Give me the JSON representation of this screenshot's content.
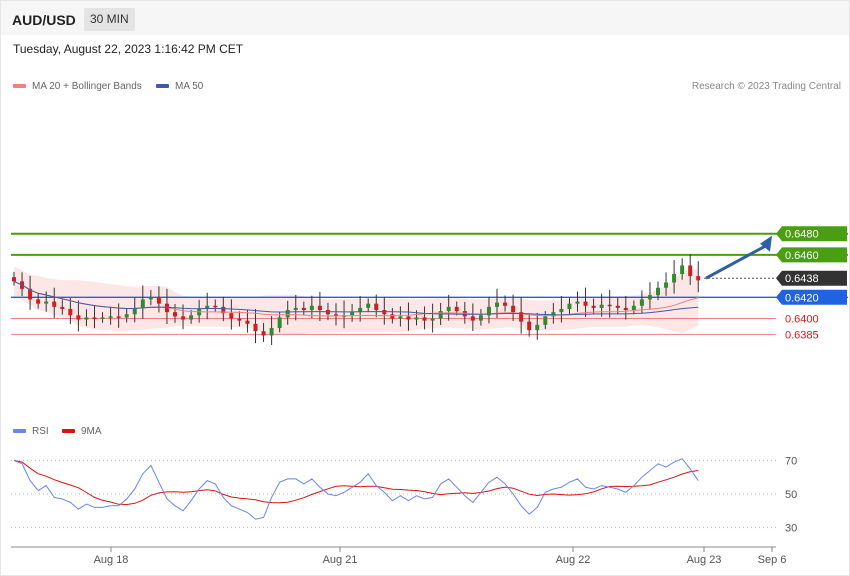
{
  "header": {
    "symbol": "AUD/USD",
    "timeframe": "30 MIN",
    "timestamp": "Tuesday, August 22, 2023 1:16:42 PM CET",
    "credit": "Research © 2023 Trading Central"
  },
  "legend": {
    "ma20": "MA 20 + Bollinger Bands",
    "ma50": "MA 50",
    "rsi": "RSI",
    "ma9": "9MA"
  },
  "colors": {
    "bull": "#2e8b2e",
    "bear": "#cc1f1f",
    "ma20": "#f08080",
    "band": "#fde3e3",
    "ma50": "#3d5ba6",
    "support_blue": "#1f63e0",
    "target_green": "#4a9e12",
    "red_level": "#f08080",
    "arrow": "#2f5fa3",
    "rsi": "#6688e8",
    "rsi_ma": "#dd1111"
  },
  "chart_data": [
    {
      "type": "candlestick",
      "title": "AUD/USD 30 MIN",
      "x_ticks": [
        "Aug 18",
        "Aug 21",
        "Aug 22",
        "Aug 23",
        "Sep 6"
      ],
      "levels": [
        {
          "label": "0.6480",
          "value": 0.648,
          "kind": "target"
        },
        {
          "label": "0.6460",
          "value": 0.646,
          "kind": "target"
        },
        {
          "label": "0.6438",
          "value": 0.6438,
          "kind": "current"
        },
        {
          "label": "0.6420",
          "value": 0.642,
          "kind": "pivot"
        },
        {
          "label": "0.6400",
          "value": 0.64,
          "kind": "support"
        },
        {
          "label": "0.6385",
          "value": 0.6385,
          "kind": "support"
        }
      ],
      "close_path": [
        0.6435,
        0.6428,
        0.6418,
        0.6414,
        0.6416,
        0.6411,
        0.6409,
        0.6403,
        0.6399,
        0.6401,
        0.64,
        0.6401,
        0.6402,
        0.6401,
        0.6404,
        0.641,
        0.6418,
        0.642,
        0.6414,
        0.6406,
        0.6402,
        0.6399,
        0.6403,
        0.6409,
        0.6412,
        0.6411,
        0.6405,
        0.64,
        0.6398,
        0.6395,
        0.6388,
        0.6384,
        0.6391,
        0.6401,
        0.6408,
        0.641,
        0.6408,
        0.6412,
        0.6408,
        0.6404,
        0.6402,
        0.6403,
        0.6406,
        0.641,
        0.6414,
        0.6408,
        0.6404,
        0.64,
        0.6402,
        0.6399,
        0.6401,
        0.6398,
        0.64,
        0.6407,
        0.6411,
        0.6407,
        0.6402,
        0.6398,
        0.6403,
        0.6411,
        0.6415,
        0.6412,
        0.6406,
        0.6397,
        0.6389,
        0.6394,
        0.6402,
        0.6406,
        0.6409,
        0.6414,
        0.6416,
        0.6412,
        0.641,
        0.6413,
        0.6412,
        0.641,
        0.6408,
        0.6412,
        0.6418,
        0.6422,
        0.6429,
        0.6434,
        0.6442,
        0.645,
        0.644,
        0.6436
      ],
      "rsi": {
        "levels": [
          70,
          50,
          30
        ],
        "values": [
          70,
          68,
          58,
          52,
          55,
          48,
          47,
          45,
          41,
          44,
          42,
          42,
          43,
          43,
          47,
          53,
          62,
          67,
          57,
          47,
          43,
          40,
          46,
          53,
          58,
          56,
          48,
          43,
          41,
          39,
          35,
          36,
          48,
          57,
          59,
          59,
          56,
          59,
          54,
          50,
          49,
          51,
          54,
          57,
          62,
          55,
          51,
          46,
          49,
          46,
          49,
          47,
          48,
          56,
          59,
          54,
          49,
          45,
          51,
          57,
          60,
          56,
          50,
          43,
          38,
          42,
          51,
          53,
          54,
          57,
          59,
          54,
          53,
          55,
          54,
          53,
          51,
          55,
          60,
          64,
          68,
          66,
          69,
          71,
          65,
          58
        ]
      }
    }
  ]
}
